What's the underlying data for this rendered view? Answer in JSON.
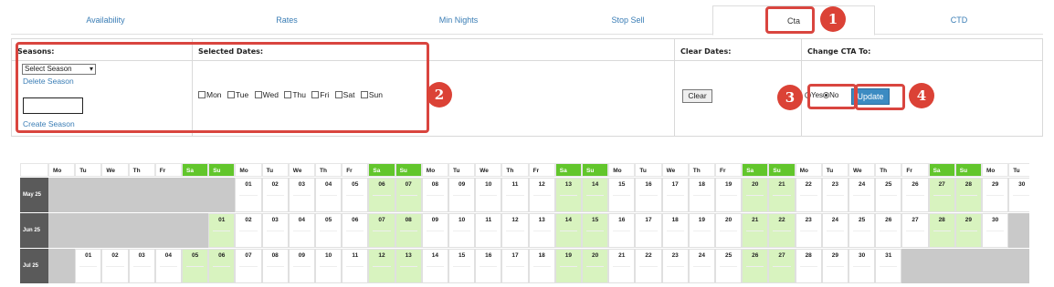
{
  "tabs": [
    {
      "label": "Availability",
      "active": false
    },
    {
      "label": "Rates",
      "active": false
    },
    {
      "label": "Min Nights",
      "active": false
    },
    {
      "label": "Stop Sell",
      "active": false
    },
    {
      "label": "Cta",
      "active": true
    },
    {
      "label": "CTD",
      "active": false
    }
  ],
  "panel": {
    "seasons": {
      "header": "Seasons:",
      "select_value": "Select Season",
      "delete_link": "Delete Season",
      "create_link": "Create Season",
      "new_season_value": ""
    },
    "selected_dates": {
      "header": "Selected Dates:",
      "days": [
        "Mon",
        "Tue",
        "Wed",
        "Thu",
        "Fri",
        "Sat",
        "Sun"
      ]
    },
    "clear_dates": {
      "header": "Clear Dates:",
      "button": "Clear"
    },
    "change_cta": {
      "header": "Change CTA To:",
      "yes_label": "Yes",
      "no_label": "No",
      "selected": "No",
      "update_button": "Update"
    }
  },
  "annotations": [
    "1",
    "2",
    "3",
    "4"
  ],
  "calendar": {
    "day_headers": [
      "Mo",
      "Tu",
      "We",
      "Th",
      "Fr",
      "Sa",
      "Su",
      "Mo",
      "Tu",
      "We",
      "Th",
      "Fr",
      "Sa",
      "Su",
      "Mo",
      "Tu",
      "We",
      "Th",
      "Fr",
      "Sa",
      "Su",
      "Mo",
      "Tu",
      "We",
      "Th",
      "Fr",
      "Sa",
      "Su",
      "Mo",
      "Tu",
      "We",
      "Th",
      "Fr",
      "Sa",
      "Su",
      "Mo",
      "Tu"
    ],
    "months": [
      {
        "label": "May 25",
        "offset": 7,
        "days": 31
      },
      {
        "label": "Jun 25",
        "offset": 6,
        "days": 30
      },
      {
        "label": "Jul 25",
        "offset": 1,
        "days": 31
      }
    ]
  },
  "colors": {
    "accent": "#3c8bc2",
    "weekend": "#62c62c",
    "weekend_cell": "#d8f3bf",
    "annotation": "#db4236"
  }
}
